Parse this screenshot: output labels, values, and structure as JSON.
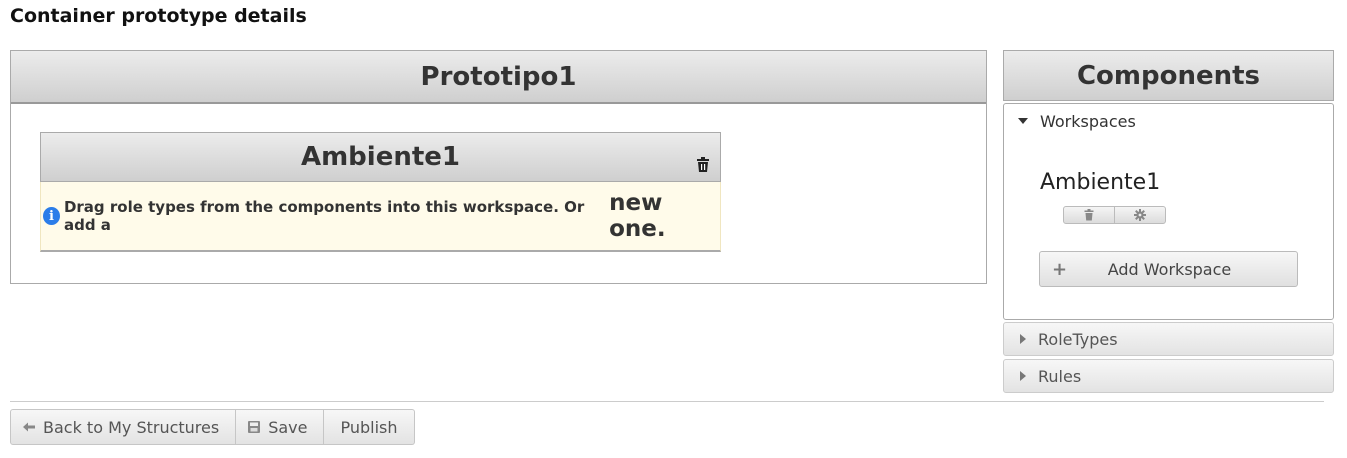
{
  "page": {
    "title": "Container prototype details"
  },
  "prototype": {
    "name": "Prototipo1",
    "workspace": {
      "name": "Ambiente1",
      "hint_text": "Drag role types from the components into this workspace. Or add a",
      "new_one_label": "new one."
    }
  },
  "components": {
    "title": "Components",
    "workspaces_section": {
      "label": "Workspaces",
      "expanded": true,
      "items": [
        {
          "name": "Ambiente1"
        }
      ],
      "add_label": "Add Workspace"
    },
    "roletypes_section": {
      "label": "RoleTypes",
      "expanded": false
    },
    "rules_section": {
      "label": "Rules",
      "expanded": false
    }
  },
  "actions": {
    "back_label": "Back to My Structures",
    "save_label": "Save",
    "publish_label": "Publish"
  },
  "icons": {
    "info": "info-icon",
    "trash": "trash-icon",
    "gear": "gear-icon",
    "plus": "plus-icon",
    "arrow_left": "arrow-left-icon",
    "save": "floppy-disk-icon"
  },
  "colors": {
    "info_blue": "#2b7de9",
    "hint_bg": "#fffbea"
  }
}
